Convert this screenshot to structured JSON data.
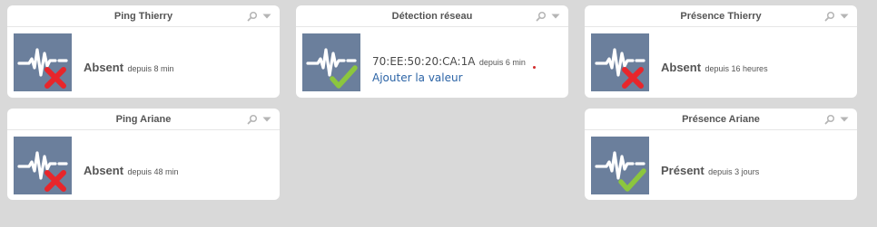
{
  "colors": {
    "background": "#d9d9d9",
    "tile": "#6b7f9c",
    "absent_mark": "#e8262b",
    "present_mark": "#8cc63e",
    "link": "#2c64a6"
  },
  "widgets": {
    "ping_thierry": {
      "title": "Ping Thierry",
      "value": "Absent",
      "since": "depuis 8 min",
      "status_icon": "absent-cross"
    },
    "ping_ariane": {
      "title": "Ping Ariane",
      "value": "Absent",
      "since": "depuis 48 min",
      "status_icon": "absent-cross"
    },
    "detection_reseau": {
      "title": "Détection réseau",
      "value": "70:EE:50:20:CA:1A",
      "since": "depuis 6 min",
      "link": "Ajouter la valeur",
      "status_icon": "present-check"
    },
    "presence_thierry": {
      "title": "Présence Thierry",
      "value": "Absent",
      "since": "depuis 16 heures",
      "status_icon": "absent-cross"
    },
    "presence_ariane": {
      "title": "Présence Ariane",
      "value": "Présent",
      "since": "depuis 3 jours",
      "status_icon": "present-check"
    }
  }
}
